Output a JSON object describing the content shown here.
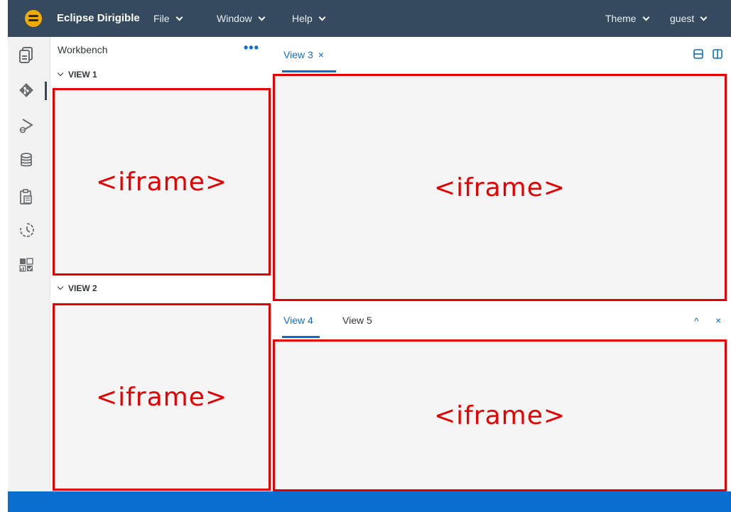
{
  "header": {
    "brand": "Eclipse Dirigible",
    "menus": [
      {
        "label": "File"
      },
      {
        "label": "Window"
      },
      {
        "label": "Help"
      }
    ],
    "right_menus": [
      {
        "label": "Theme"
      },
      {
        "label": "guest"
      }
    ]
  },
  "activity_bar": {
    "icons": [
      "workbench-icon",
      "git-icon",
      "debug-icon",
      "database-icon",
      "clipboard-icon",
      "history-icon",
      "dashboard-icon"
    ]
  },
  "left_panel": {
    "title": "Workbench",
    "menu_dots": "•••",
    "sections": [
      {
        "label": "VIEW 1",
        "frame_text": "<iframe>"
      },
      {
        "label": "VIEW 2",
        "frame_text": "<iframe>"
      }
    ]
  },
  "top_pane": {
    "tabs": [
      {
        "label": "View 3",
        "close": "×"
      }
    ],
    "frame_text": "<iframe>"
  },
  "bottom_pane": {
    "tabs": [
      {
        "label": "View 4"
      },
      {
        "label": "View 5"
      }
    ],
    "collapse": "^",
    "close": "×",
    "frame_text": "<iframe>"
  },
  "colors": {
    "header_bg": "#354a5f",
    "accent": "#0a6ed1",
    "iframe_border": "#e60000",
    "status_bar": "#0a6ed1"
  }
}
